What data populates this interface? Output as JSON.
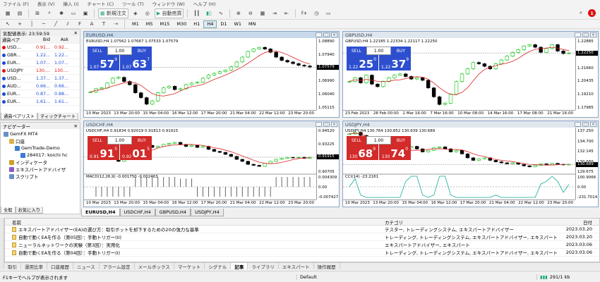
{
  "menu": [
    "ファイル (F)",
    "表示 (V)",
    "挿入 (I)",
    "チャート (C)",
    "ツール (T)",
    "ウィンドウ (W)",
    "ヘルプ (H)"
  ],
  "toolbar": {
    "new_order": "新規注文",
    "auto_trade": "自動売買",
    "timeframes": [
      "M1",
      "M5",
      "M15",
      "M30",
      "H1",
      "H4",
      "D1",
      "W1",
      "MN"
    ],
    "active_timeframe": "H4",
    "notification_count": "1"
  },
  "market_watch": {
    "title": "気配値表示: 23:59:59",
    "headers": {
      "symbol": "通貨ペア",
      "bid": "Bid",
      "ask": "Ask"
    },
    "rows": [
      {
        "symbol": "USD...",
        "bid": "0.91...",
        "ask": "0.92...",
        "color": "red"
      },
      {
        "symbol": "GBR...",
        "bid": "1.22...",
        "ask": "1.22...",
        "color": "blue"
      },
      {
        "symbol": "EUR...",
        "bid": "1.07...",
        "ask": "1.07...",
        "color": "blue"
      },
      {
        "symbol": "USDJPY",
        "bid": "130....",
        "ask": "130....",
        "color": "red"
      },
      {
        "symbol": "USD...",
        "bid": "1.37...",
        "ask": "1.37...",
        "color": "blue"
      },
      {
        "symbol": "AUD...",
        "bid": "0.66...",
        "ask": "0.66...",
        "color": "blue"
      },
      {
        "symbol": "EUR...",
        "bid": "0.87...",
        "ask": "0.88...",
        "color": "blue"
      },
      {
        "symbol": "EUR...",
        "bid": "1.61...",
        "ask": "1.61...",
        "color": "blue"
      }
    ],
    "tabs": [
      "通貨ペアリスト",
      "ティックチャート"
    ]
  },
  "navigator": {
    "title": "ナビゲーター",
    "items": [
      {
        "label": "GemFX MT4",
        "indent": 0
      },
      {
        "label": "口座",
        "indent": 1
      },
      {
        "label": "GemTrade-Demo",
        "indent": 2
      },
      {
        "label": "284017: koichi hc",
        "indent": 3
      },
      {
        "label": "インディケータ",
        "indent": 1
      },
      {
        "label": "エキスパートアドバイザ",
        "indent": 1
      },
      {
        "label": "スクリプト",
        "indent": 1
      }
    ],
    "tabs": [
      "全般",
      "お気に入り"
    ]
  },
  "charts": [
    {
      "title": "EURUSD,H4",
      "info": "EURUSD,H4  1.07562 1.07667 1.07533 1.07579",
      "theme": "blue",
      "sell": "SELL",
      "buy": "BUY",
      "lot": "1.00",
      "bid_small": "1.07",
      "bid_big": "57",
      "bid_sup": "9",
      "ask_small": "1.07",
      "ask_big": "63",
      "ask_sup": "7",
      "prices": [
        "1.08890",
        "1.07940",
        "1.07579",
        "1.06990",
        "1.06040",
        "1.05115"
      ],
      "times": [
        "10 Mar 2023",
        "13 Mar 20:00",
        "15 Mar 04:00",
        "16 Mar 12:00",
        "17 Mar 20:00",
        "21 Mar 04:00",
        "22 Mar 12:00",
        "23 Mar 20:00"
      ],
      "current": "1.07579",
      "series": [
        1.0605,
        1.0625,
        1.063,
        1.066,
        1.069,
        1.0695,
        1.067,
        1.065,
        1.06,
        1.057,
        1.053,
        1.055,
        1.06,
        1.063,
        1.064,
        1.062,
        1.0625,
        1.065,
        1.066,
        1.0665,
        1.069,
        1.071,
        1.072,
        1.073,
        1.074,
        1.076,
        1.079,
        1.082,
        1.0855,
        1.087,
        1.088,
        1.087,
        1.085,
        1.082,
        1.08,
        1.079,
        1.078,
        1.077,
        1.0765,
        1.0758
      ],
      "ylim": [
        1.05115,
        1.092
      ]
    },
    {
      "title": "GBPUSD,H4",
      "info": "GBPUSD,H4  1.22185 1.22334 1.22117 1.22250",
      "theme": "blue",
      "sell": "SELL",
      "buy": "BUY",
      "lot": "1.00",
      "bid_small": "1.22",
      "bid_big": "25",
      "bid_sup": "0",
      "ask_small": "1.22",
      "ask_big": "37",
      "ask_sup": "9",
      "prices": [
        "1.22885",
        "1.22250",
        "1.21660",
        "1.20435",
        "1.19210",
        "1.17985"
      ],
      "times": [
        "23 Feb 2023",
        "28 Feb 00:00",
        "2 Mar 16:00",
        "7 Mar 16:00",
        "10 Mar 08:00",
        "14 Mar 16:00",
        "17 Mar 08:00",
        "21 Mar 16:00"
      ],
      "current": "1.22250",
      "series": [
        1.2,
        1.203,
        1.199,
        1.205,
        1.198,
        1.196,
        1.2,
        1.203,
        1.205,
        1.206,
        1.204,
        1.202,
        1.203,
        1.201,
        1.195,
        1.188,
        1.182,
        1.183,
        1.19,
        1.2,
        1.206,
        1.21,
        1.215,
        1.214,
        1.212,
        1.21,
        1.214,
        1.217,
        1.22,
        1.223,
        1.225,
        1.228,
        1.229,
        1.227,
        1.223,
        1.226,
        1.229,
        1.224,
        1.222,
        1.2225
      ],
      "ylim": [
        1.17985,
        1.232
      ]
    },
    {
      "title": "USDCHF,H4",
      "info": "USDCHF,H4  0.91834 0.92019 0.91813 0.91915",
      "theme": "red",
      "sell": "SELL",
      "buy": "BUY",
      "lot": "1.00",
      "bid_small": "0.91",
      "bid_big": "91",
      "bid_sup": "5",
      "ask_small": "0.92",
      "ask_big": "01",
      "ask_sup": "5",
      "prices": [
        "0.94520",
        "0.93225",
        "0.91915",
        "0.90705"
      ],
      "times": [
        "10 Mar 2023",
        "13 Mar 20:00",
        "15 Mar 04:00",
        "16 Mar 12:00",
        "17 Mar 20:00",
        "21 Mar 04:00",
        "22 Mar 12:00",
        "23 Mar 20:00"
      ],
      "current": "0.91915",
      "indicator_label": "MACD(12,26,9) -0.001750 -0.002463",
      "indicator_scale": [
        "0.004309",
        "0.00",
        "-0.007427"
      ],
      "series": [
        0.93,
        0.925,
        0.92,
        0.918,
        0.917,
        0.915,
        0.918,
        0.923,
        0.927,
        0.93,
        0.931,
        0.929,
        0.93,
        0.932,
        0.933,
        0.934,
        0.932,
        0.93,
        0.931,
        0.929,
        0.93,
        0.927,
        0.925,
        0.924,
        0.922,
        0.92,
        0.917,
        0.915,
        0.912,
        0.911,
        0.91,
        0.913,
        0.915,
        0.917,
        0.918,
        0.919,
        0.9185,
        0.9191,
        0.918,
        0.9191
      ],
      "ylim": [
        0.905,
        0.946
      ]
    },
    {
      "title": "USDJPY,H4",
      "info": "USDJPY,H4  130.764 130.852 130.639 130.689",
      "theme": "red",
      "sell": "SELL",
      "buy": "BUY",
      "lot": "1.00",
      "bid_small": "130",
      "bid_big": "68",
      "bid_sup": "9",
      "ask_small": "130",
      "ask_big": "74",
      "ask_sup": "0",
      "prices": [
        "137.250",
        "134.700",
        "132.145",
        "130.689",
        "129.675"
      ],
      "times": [
        "10 Mar 2023",
        "13 Mar 20:00",
        "15 Mar 04:00",
        "16 Mar 12:00",
        "17 Mar 20:00",
        "21 Mar 04:00",
        "22 Mar 12:00",
        "23 Mar 20:00"
      ],
      "current": "130.689",
      "indicator_label": "CCI(14) -23.2161",
      "indicator_scale": [
        "100.9066",
        "0.00",
        "-231.7014"
      ],
      "series": [
        136.8,
        137.1,
        136.5,
        135.0,
        134.0,
        134.5,
        133.8,
        133.0,
        132.5,
        133.5,
        134.0,
        134.3,
        133.8,
        133.2,
        133.5,
        134.0,
        134.2,
        133.8,
        133.2,
        133.5,
        132.8,
        132.0,
        131.5,
        131.8,
        132.0,
        131.5,
        131.2,
        131.0,
        130.8,
        131.0,
        130.7,
        130.4,
        130.2,
        130.5,
        130.8,
        130.6,
        130.9,
        130.7,
        130.6,
        130.689
      ],
      "ylim": [
        129.3,
        137.5
      ]
    }
  ],
  "chart_tabs": [
    "EURUSD,H4",
    "USDCHF,H4",
    "GBPUSD,H4",
    "USDJPY,H4"
  ],
  "terminal": {
    "headers": {
      "name": "名前",
      "category": "カテゴリ",
      "date": "日付"
    },
    "rows": [
      {
        "name": "エキスパートアドバイザー(EA)の選び方：取引ボットを却下するための20の強力な基準",
        "category": "テスター, トレーディングシステム, エキスパートアドバイザー",
        "date": "2023.03.20"
      },
      {
        "name": "自動で動くEAを作る（第05回）：手動トリガー(II)",
        "category": "トレーディング, トレーディングシステム, エキスパートアドバイザー, エキスパート",
        "date": "2023.03.20"
      },
      {
        "name": "ニューラルネットワークの実験（第3回）：実用化",
        "category": "エキスパートアドバイザー, エキスパート",
        "date": "2023.03.06"
      },
      {
        "name": "自動で動くEAを作る（第04回）：手動トリガー(I)",
        "category": "トレーディング, トレーディングシステム, エキスパートアドバイザー, エキスパート",
        "date": "2023.03.06"
      }
    ],
    "tabs": [
      "取引",
      "運用比率",
      "口座履歴",
      "ニュース",
      "アラーム設定",
      "メールボックス",
      "マーケット",
      "シグナル",
      "記事",
      "ライブラリ",
      "エキスパート",
      "操作履歴"
    ],
    "active_tab": "記事",
    "side_label": "ターミナル"
  },
  "status": {
    "help": "F1キーでヘルプが表示されます",
    "profile": "Default",
    "traffic": "291/1 kb"
  },
  "colors": {
    "bid_ask": "#1a4bd6",
    "sell_blue": "#2d4fcf",
    "sell_red": "#d32a2a",
    "bull": "#00c000"
  }
}
